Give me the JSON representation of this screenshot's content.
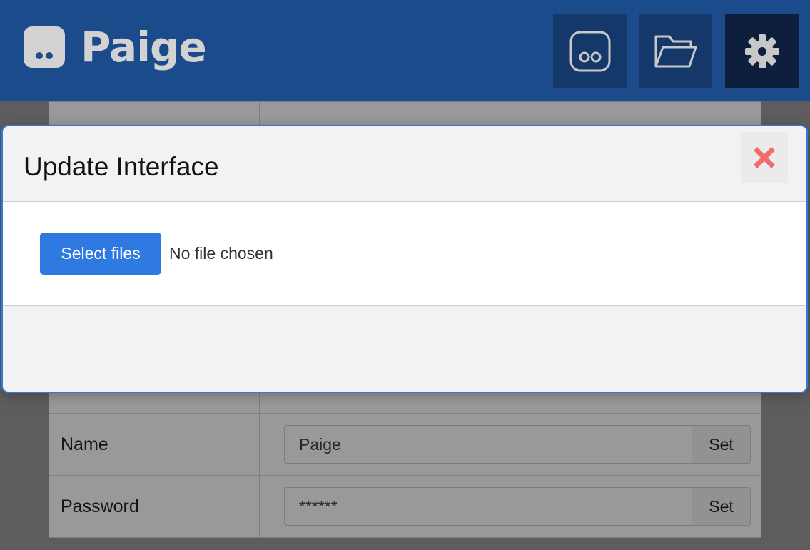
{
  "header": {
    "brand": "Paige",
    "nav": [
      {
        "icon": "robot-face-icon",
        "active": false
      },
      {
        "icon": "folder-icon",
        "active": false
      },
      {
        "icon": "gear-icon",
        "active": true
      }
    ]
  },
  "settings": {
    "rows": [
      {
        "label": "Name",
        "value": "Paige",
        "button": "Set"
      },
      {
        "label": "Password",
        "value": "******",
        "button": "Set"
      }
    ]
  },
  "modal": {
    "title": "Update Interface",
    "select_label": "Select files",
    "file_status": "No file chosen",
    "close_icon": "close-icon"
  },
  "colors": {
    "header": "#1b4b8a",
    "nav_button": "#14386a",
    "nav_button_active": "#0d1f3c",
    "accent": "#2e7ae0",
    "close": "#f26b6b"
  }
}
